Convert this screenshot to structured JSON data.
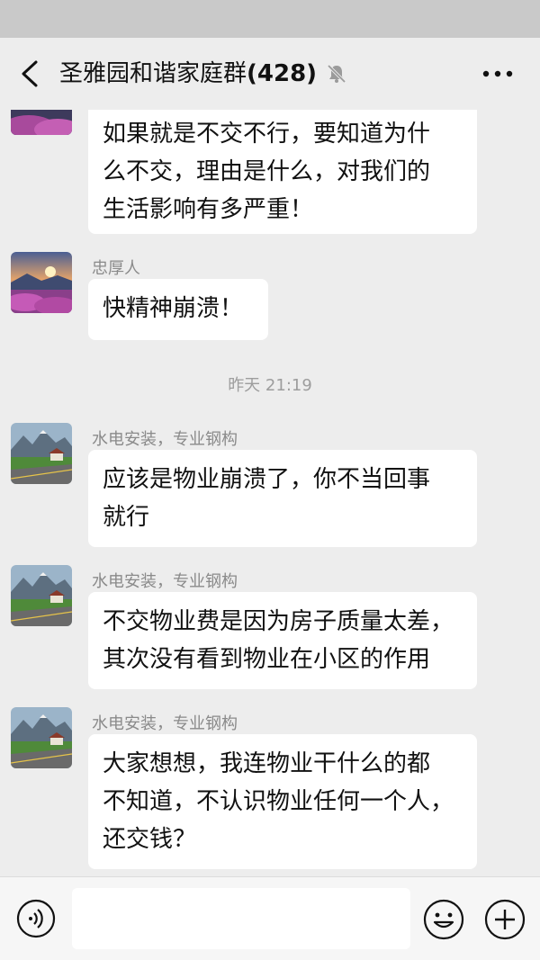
{
  "header": {
    "title": "圣雅园和谐家庭群",
    "member_count": "(428)",
    "back_icon": "chevron-left-icon",
    "mute_icon": "bell-mute-icon",
    "more_icon": "ellipsis-icon"
  },
  "messages": [
    {
      "sender": "",
      "avatar": "flower-field-sunset-avatar",
      "lines": [
        "如果就是不交不行，要知道为什",
        "么不交，理由是什么，对我们的",
        "生活影响有多严重！"
      ]
    },
    {
      "sender": "忠厚人",
      "avatar": "flower-field-sunset-avatar",
      "lines": [
        "快精神崩溃！"
      ]
    },
    {
      "sender": "水电安装，专业钢构",
      "avatar": "mountain-road-avatar",
      "lines": [
        "应该是物业崩溃了，你不当回事",
        "就行"
      ]
    },
    {
      "sender": "水电安装，专业钢构",
      "avatar": "mountain-road-avatar",
      "lines": [
        "不交物业费是因为房子质量太差，",
        "其次没有看到物业在小区的作用"
      ]
    },
    {
      "sender": "水电安装，专业钢构",
      "avatar": "mountain-road-avatar",
      "lines": [
        "大家想想，我连物业干什么的都",
        "不知道，不认识物业任何一个人，",
        "还交钱？"
      ]
    }
  ],
  "time_separator": "昨天 21:19",
  "input_bar": {
    "voice_icon": "voice-icon",
    "emoji_icon": "emoji-icon",
    "plus_icon": "plus-icon",
    "input_value": ""
  },
  "colors": {
    "background": "#ededed",
    "bubble": "#ffffff",
    "status_bar": "#c9c9c9"
  }
}
